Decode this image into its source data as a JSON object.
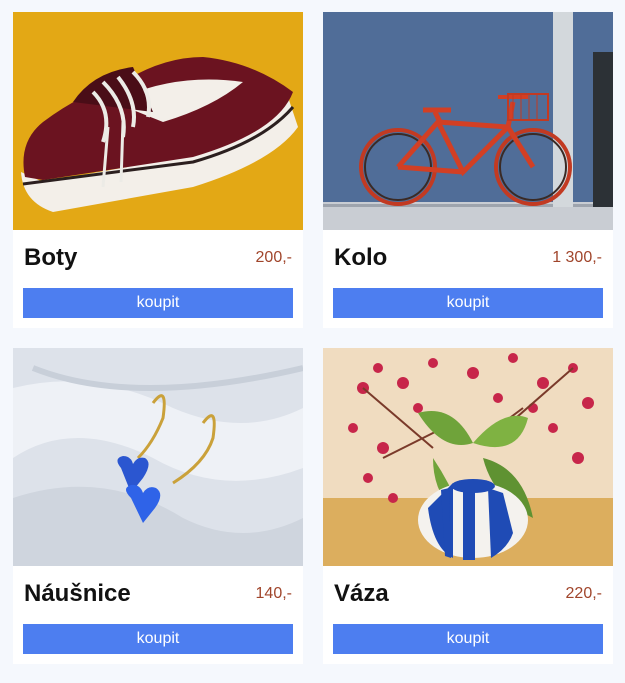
{
  "products": [
    {
      "name": "Boty",
      "price": "200,-",
      "button": "koupit",
      "image": "red-sneaker-photo"
    },
    {
      "name": "Kolo",
      "price": "1 300,-",
      "button": "koupit",
      "image": "red-bicycle-photo"
    },
    {
      "name": "Náušnice",
      "price": "140,-",
      "button": "koupit",
      "image": "blue-heart-earrings-photo"
    },
    {
      "name": "Váza",
      "price": "220,-",
      "button": "koupit",
      "image": "flower-vase-photo"
    }
  ],
  "colors": {
    "button_bg": "#4d7ef0",
    "price": "#a0452b",
    "page_bg": "#f5f8fd"
  }
}
